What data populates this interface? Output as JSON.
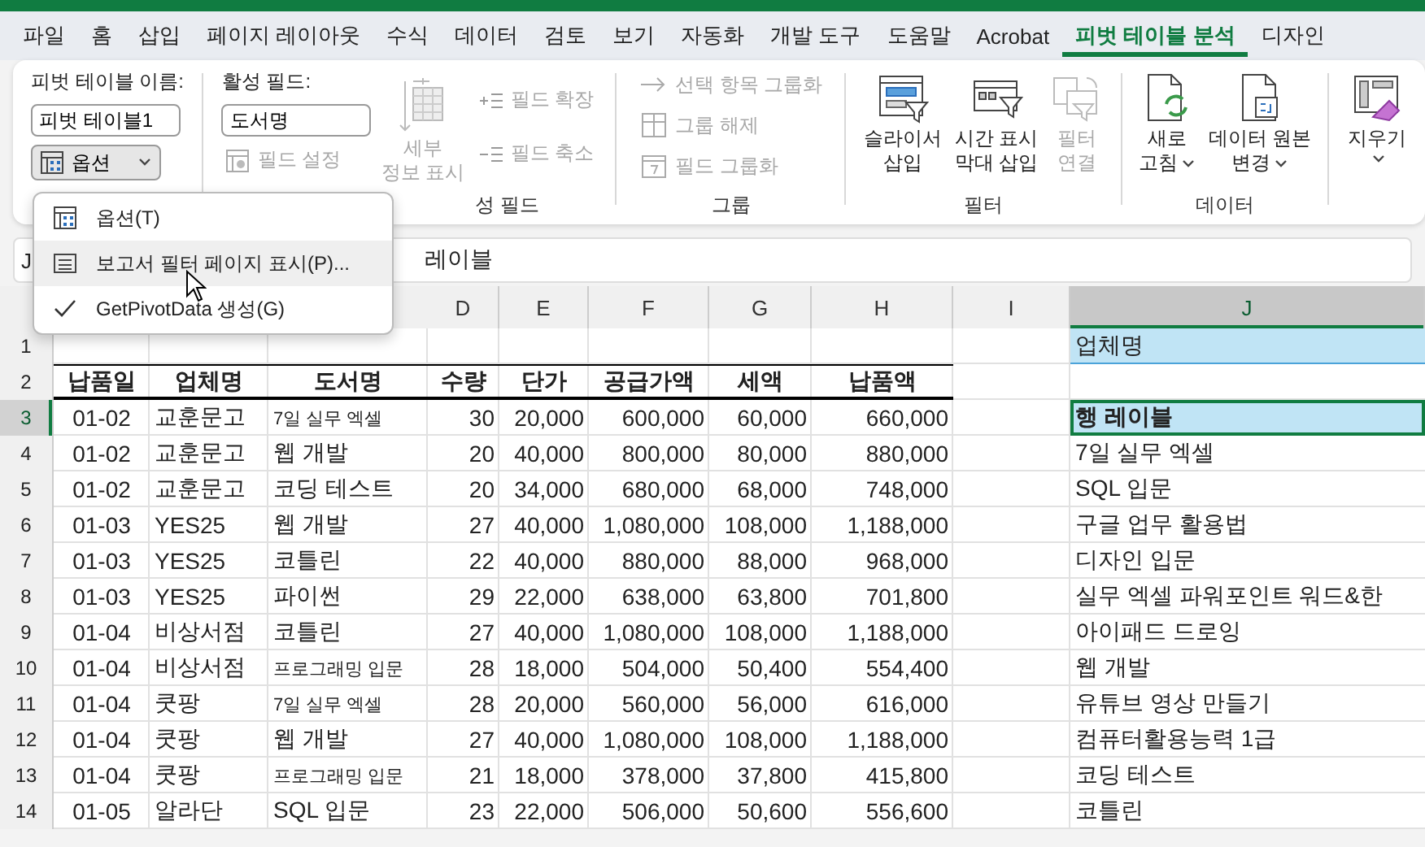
{
  "tabs": [
    {
      "label": "파일",
      "selected": false
    },
    {
      "label": "홈",
      "selected": false
    },
    {
      "label": "삽입",
      "selected": false
    },
    {
      "label": "페이지 레이아웃",
      "selected": false
    },
    {
      "label": "수식",
      "selected": false
    },
    {
      "label": "데이터",
      "selected": false
    },
    {
      "label": "검토",
      "selected": false
    },
    {
      "label": "보기",
      "selected": false
    },
    {
      "label": "자동화",
      "selected": false
    },
    {
      "label": "개발 도구",
      "selected": false
    },
    {
      "label": "도움말",
      "selected": false
    },
    {
      "label": "Acrobat",
      "selected": false
    },
    {
      "label": "피벗 테이블 분석",
      "selected": true
    },
    {
      "label": "디자인",
      "selected": false
    }
  ],
  "pivot_table": {
    "name_label": "피벗 테이블 이름:",
    "name_value": "피벗 테이블1",
    "options_button": {
      "label": "옵션",
      "expanded": true
    }
  },
  "active_field": {
    "field_label": "활성 필드:",
    "field_value": "도서명",
    "field_settings": {
      "label": "필드 설정",
      "disabled": true
    },
    "show_details": {
      "label": "세부\n정보 표시",
      "disabled": true
    },
    "small_buttons": [
      {
        "label": "필드 확장",
        "kind": "expand",
        "disabled": true
      },
      {
        "label": "필드 축소",
        "kind": "collapse",
        "disabled": true
      }
    ],
    "group_label": "성 필드"
  },
  "group": {
    "items": [
      {
        "label": "선택 항목 그룹화",
        "kind": "group-selection",
        "disabled": true
      },
      {
        "label": "그룹 해제",
        "kind": "ungroup",
        "disabled": true
      },
      {
        "label": "필드 그룹화",
        "kind": "group-field",
        "disabled": true
      }
    ],
    "group_label": "그룹"
  },
  "filter": {
    "buttons": [
      {
        "label": "슬라이서\n삽입",
        "kind": "slicer",
        "disabled": false
      },
      {
        "label": "시간 표시\n막대 삽입",
        "kind": "timeline",
        "disabled": false
      },
      {
        "label": "필터\n연결",
        "kind": "connect",
        "disabled": true
      }
    ],
    "group_label": "필터"
  },
  "data": {
    "buttons": [
      {
        "label": "새로\n고침",
        "kind": "refresh",
        "dropdown": true
      },
      {
        "label": "데이터 원본\n변경",
        "kind": "source",
        "dropdown": true
      }
    ],
    "group_label": "데이터"
  },
  "clear": {
    "label": "지우기",
    "dropdown": true
  },
  "formula_bar": {
    "name_box": "J",
    "formula": "레이블"
  },
  "options_menu": {
    "items": [
      {
        "label": "옵션(T)",
        "kind": "options",
        "highlighted": false
      },
      {
        "label": "보고서 필터 페이지 표시(P)...",
        "kind": "report",
        "highlighted": true
      },
      {
        "label": "GetPivotData 생성(G)",
        "kind": "getpivot",
        "checked": true,
        "highlighted": false
      }
    ]
  },
  "sheet": {
    "columns": [
      {
        "label": "D",
        "selected": false
      },
      {
        "label": "E",
        "selected": false
      },
      {
        "label": "F",
        "selected": false
      },
      {
        "label": "G",
        "selected": false
      },
      {
        "label": "H",
        "selected": false
      },
      {
        "label": "I",
        "selected": false
      },
      {
        "label": "J",
        "selected": true
      }
    ],
    "rows": [
      {
        "number": "1",
        "selected": false,
        "pivot": {
          "text": "업체명",
          "kind": "filter_field",
          "selected": false
        }
      },
      {
        "number": "2",
        "selected": false,
        "kind": "header",
        "table": [
          "납품일",
          "업체명",
          "도서명",
          "수량",
          "단가",
          "공급가액",
          "세액",
          "납품액"
        ]
      },
      {
        "number": "3",
        "selected": true,
        "table": [
          "01-02",
          "교훈문고",
          "7일 실무 엑셀",
          "30",
          "20,000",
          "600,000",
          "60,000",
          "660,000"
        ],
        "pivot": {
          "text": "행 레이블",
          "kind": "row_header",
          "selected": true
        }
      },
      {
        "number": "4",
        "selected": false,
        "table": [
          "01-02",
          "교훈문고",
          "웹 개발",
          "20",
          "40,000",
          "800,000",
          "80,000",
          "880,000"
        ],
        "pivot": {
          "text": "7일 실무 엑셀",
          "kind": "item",
          "selected": false
        }
      },
      {
        "number": "5",
        "selected": false,
        "table": [
          "01-02",
          "교훈문고",
          "코딩 테스트",
          "20",
          "34,000",
          "680,000",
          "68,000",
          "748,000"
        ],
        "pivot": {
          "text": "SQL 입문",
          "kind": "item",
          "selected": false
        }
      },
      {
        "number": "6",
        "selected": false,
        "table": [
          "01-03",
          "YES25",
          "웹 개발",
          "27",
          "40,000",
          "1,080,000",
          "108,000",
          "1,188,000"
        ],
        "pivot": {
          "text": "구글 업무 활용법",
          "kind": "item",
          "selected": false
        }
      },
      {
        "number": "7",
        "selected": false,
        "table": [
          "01-03",
          "YES25",
          "코틀린",
          "22",
          "40,000",
          "880,000",
          "88,000",
          "968,000"
        ],
        "pivot": {
          "text": "디자인 입문",
          "kind": "item",
          "selected": false
        }
      },
      {
        "number": "8",
        "selected": false,
        "table": [
          "01-03",
          "YES25",
          "파이썬",
          "29",
          "22,000",
          "638,000",
          "63,800",
          "701,800"
        ],
        "pivot": {
          "text": "실무 엑셀 파워포인트 워드&한",
          "kind": "item",
          "selected": false
        }
      },
      {
        "number": "9",
        "selected": false,
        "table": [
          "01-04",
          "비상서점",
          "코틀린",
          "27",
          "40,000",
          "1,080,000",
          "108,000",
          "1,188,000"
        ],
        "pivot": {
          "text": "아이패드 드로잉",
          "kind": "item",
          "selected": false
        }
      },
      {
        "number": "10",
        "selected": false,
        "table": [
          "01-04",
          "비상서점",
          "프로그래밍 입문",
          "28",
          "18,000",
          "504,000",
          "50,400",
          "554,400"
        ],
        "pivot": {
          "text": "웹 개발",
          "kind": "item",
          "selected": false
        }
      },
      {
        "number": "11",
        "selected": false,
        "table": [
          "01-04",
          "쿳팡",
          "7일 실무 엑셀",
          "28",
          "20,000",
          "560,000",
          "56,000",
          "616,000"
        ],
        "pivot": {
          "text": "유튜브 영상 만들기",
          "kind": "item",
          "selected": false
        }
      },
      {
        "number": "12",
        "selected": false,
        "table": [
          "01-04",
          "쿳팡",
          "웹 개발",
          "27",
          "40,000",
          "1,080,000",
          "108,000",
          "1,188,000"
        ],
        "pivot": {
          "text": "컴퓨터활용능력 1급",
          "kind": "item",
          "selected": false
        }
      },
      {
        "number": "13",
        "selected": false,
        "table": [
          "01-04",
          "쿳팡",
          "프로그래밍 입문",
          "21",
          "18,000",
          "378,000",
          "37,800",
          "415,800"
        ],
        "pivot": {
          "text": "코딩 테스트",
          "kind": "item",
          "selected": false
        }
      },
      {
        "number": "14",
        "selected": false,
        "table": [
          "01-05",
          "알라단",
          "SQL 입문",
          "23",
          "22,000",
          "506,000",
          "50,600",
          "556,600"
        ],
        "pivot": {
          "text": "코틀린",
          "kind": "item",
          "selected": false
        }
      }
    ]
  }
}
